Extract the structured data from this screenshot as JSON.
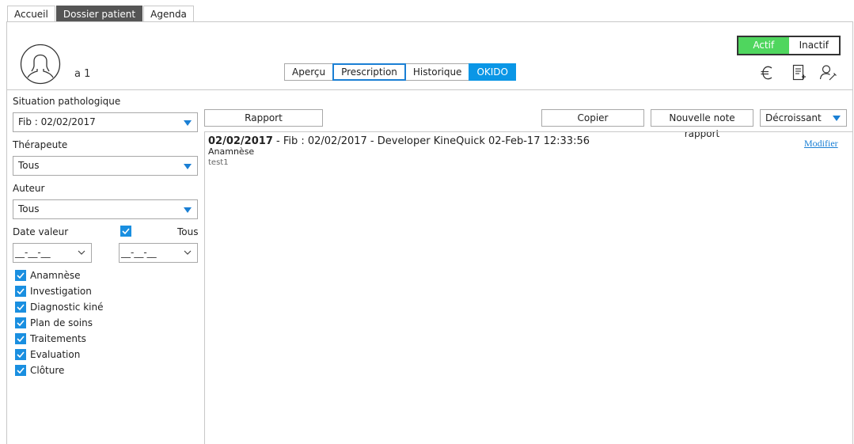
{
  "top_tabs": [
    {
      "label": "Accueil",
      "active": false
    },
    {
      "label": "Dossier patient",
      "active": true
    },
    {
      "label": "Agenda",
      "active": false
    }
  ],
  "patient": {
    "name": "a 1",
    "avatar_icon": "user-silhouette-icon"
  },
  "view_tabs": [
    {
      "label": "Aperçu"
    },
    {
      "label": "Prescription",
      "selected": true
    },
    {
      "label": "Historique"
    },
    {
      "label": "OKIDO",
      "highlight": true
    }
  ],
  "status": {
    "active_label": "Actif",
    "inactive_label": "Inactif",
    "current": "Actif",
    "active_color": "#4fd65e"
  },
  "header_icons": [
    "euro-icon",
    "invoice-add-icon",
    "user-edit-icon"
  ],
  "sidebar": {
    "situation": {
      "label": "Situation pathologique",
      "value": "Fib : 02/02/2017"
    },
    "therapist": {
      "label": "Thérapeute",
      "value": "Tous"
    },
    "author": {
      "label": "Auteur",
      "value": "Tous"
    },
    "date": {
      "label": "Date valeur",
      "all_label": "Tous",
      "all_checked": true,
      "from": "__-__-__",
      "to": "__-__-__"
    },
    "categories": [
      {
        "label": "Anamnèse",
        "checked": true
      },
      {
        "label": "Investigation",
        "checked": true
      },
      {
        "label": "Diagnostic kiné",
        "checked": true
      },
      {
        "label": "Plan de soins",
        "checked": true
      },
      {
        "label": "Traitements",
        "checked": true
      },
      {
        "label": "Evaluation",
        "checked": true
      },
      {
        "label": "Clôture",
        "checked": true
      }
    ]
  },
  "toolbar": {
    "report_label": "Rapport",
    "copy_label": "Copier",
    "new_note_label": "Nouvelle note rapport",
    "sort_value": "Décroissant"
  },
  "note": {
    "date": "02/02/2017",
    "details": " - Fib : 02/02/2017 - Developer KineQuick 02-Feb-17 12:33:56",
    "category": "Anamnèse",
    "body": "test1",
    "edit_label": "Modifier"
  },
  "colors": {
    "accent": "#1a7fd4",
    "okido": "#0a96e6",
    "active_tab": "#555555"
  }
}
